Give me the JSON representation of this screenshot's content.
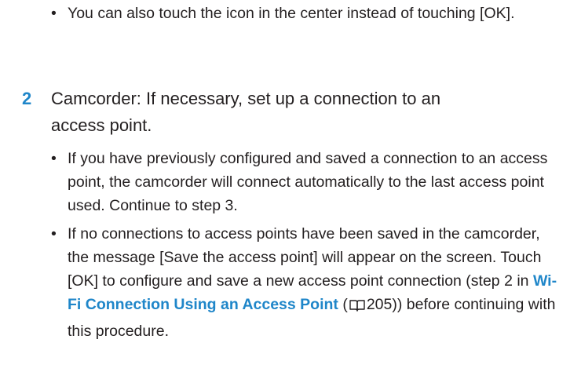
{
  "top_note": {
    "bullet": "•",
    "text": "You can also touch the icon in the center instead of touching [OK]."
  },
  "step2": {
    "number": "2",
    "title": "Camcorder: If necessary, set up a connection to an access point.",
    "bullets": [
      {
        "bullet": "•",
        "text": "If you have previously configured and saved a connection to an access point, the camcorder will connect automatically to the last access point used. Continue to step 3."
      },
      {
        "bullet": "•",
        "text_before": "If no connections to access points have been saved in the camcorder, the message [Save the access point] will appear on the screen. Touch [OK] to configure and save a new access point connection (step 2 in",
        "link": "Wi-Fi Connection Using an Access Point",
        "paren_open": " (",
        "page_ref": "205",
        "text_after": ")) before continuing with this procedure."
      }
    ]
  },
  "icons": {
    "page_reference": "book-icon"
  },
  "colors": {
    "accent": "#1f86c9",
    "text": "#231f20"
  }
}
